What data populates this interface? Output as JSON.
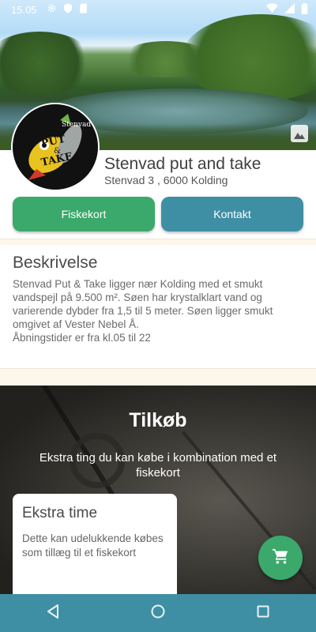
{
  "status_bar": {
    "time": "15.05",
    "icons": [
      "settings-icon",
      "shield-icon",
      "sd-card-icon",
      "wifi-icon",
      "signal-icon",
      "battery-icon"
    ]
  },
  "header": {
    "title": "Stenvad put and take",
    "address": "Stenvad 3 , 6000 Kolding",
    "logo_text_top": "Stenvad",
    "logo_text_put": "PUT",
    "logo_text_amp": "&",
    "logo_text_take": "TAKE"
  },
  "buttons": {
    "fiskekort": "Fiskekort",
    "kontakt": "Kontakt"
  },
  "description": {
    "title": "Beskrivelse",
    "body": "Stenvad Put & Take ligger nær Kolding med et smukt vandspejl på 9.500 m². Søen har krystalklart vand og varierende dybder fra 1,5 til 5 meter. Søen ligger smukt omgivet af Vester Nebel Å.\nÅbningstider er fra kl.05 til 22"
  },
  "tilkob": {
    "title": "Tilkøb",
    "subtitle": "Ekstra ting du kan købe i kombination med et fiskekort",
    "cards": [
      {
        "title": "Ekstra time",
        "body": "Dette kan udelukkende købes som tillæg til et fiskekort"
      }
    ]
  },
  "fab": {
    "icon": "cart-icon"
  },
  "navbar": {
    "icons": [
      "back-icon",
      "home-icon",
      "recents-icon"
    ]
  },
  "colors": {
    "primary_green": "#3aa96b",
    "primary_teal": "#3f8fa4",
    "section_band": "#fdf6ea"
  }
}
